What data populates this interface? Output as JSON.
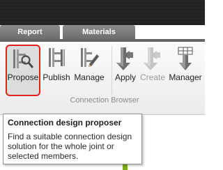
{
  "ribbon": {
    "tabs": [
      {
        "label": "Report"
      },
      {
        "label": "Materials"
      }
    ],
    "buttons": [
      {
        "label": "Propose",
        "icon": "connection-propose-icon",
        "state": "selected"
      },
      {
        "label": "Publish",
        "icon": "connection-publish-icon",
        "state": "enabled"
      },
      {
        "label": "Manage",
        "icon": "connection-manage-icon",
        "state": "enabled"
      },
      {
        "label": "Apply",
        "icon": "apply-icon",
        "state": "enabled"
      },
      {
        "label": "Create",
        "icon": "create-icon",
        "state": "disabled"
      },
      {
        "label": "Manager",
        "icon": "manager-icon",
        "state": "enabled"
      }
    ],
    "group_label": "Connection Browser",
    "highlight_color": "#e12020"
  },
  "tooltip": {
    "title": "Connection design proposer",
    "description": "Find a suitable connection design solution for the whole joint or selected members."
  }
}
